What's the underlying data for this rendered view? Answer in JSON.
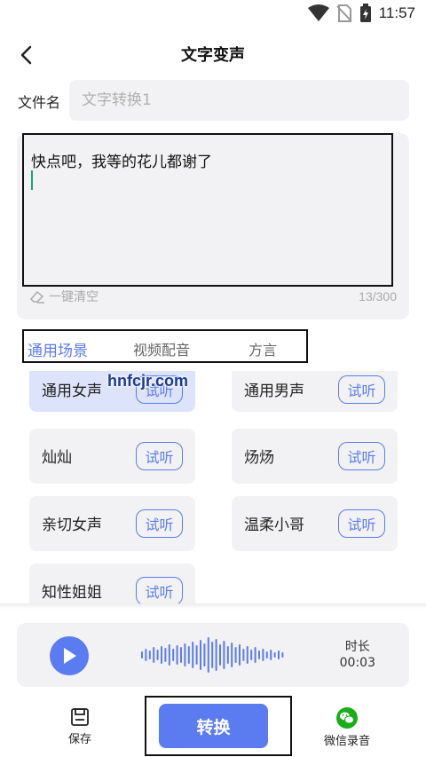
{
  "status_bar": {
    "time": "11:57",
    "icons": [
      "wifi-icon",
      "no-sim-icon",
      "battery-charging-icon"
    ]
  },
  "header": {
    "title": "文字变声",
    "back_icon": "chevron-left-icon"
  },
  "filename": {
    "label": "文件名",
    "placeholder": "文字转换1"
  },
  "text_editor": {
    "content": "快点吧，我等的花儿都谢了",
    "clear_label": "一键清空",
    "char_count": "13/300"
  },
  "tabs": [
    {
      "label": "通用场景",
      "active": true
    },
    {
      "label": "视频配音",
      "active": false
    },
    {
      "label": "方言",
      "active": false
    }
  ],
  "voices": [
    {
      "name": "通用女声",
      "try_label": "试听",
      "selected": true
    },
    {
      "name": "通用男声",
      "try_label": "试听",
      "selected": false
    },
    {
      "name": "灿灿",
      "try_label": "试听",
      "selected": false
    },
    {
      "name": "炀炀",
      "try_label": "试听",
      "selected": false
    },
    {
      "name": "亲切女声",
      "try_label": "试听",
      "selected": false
    },
    {
      "name": "温柔小哥",
      "try_label": "试听",
      "selected": false
    },
    {
      "name": "知性姐姐",
      "try_label": "试听",
      "selected": false
    }
  ],
  "watermark": "hnfcjr.com",
  "player": {
    "duration_label": "时长",
    "duration_value": "00:03"
  },
  "bottom_bar": {
    "save_label": "保存",
    "convert_label": "转换",
    "wechat_label": "微信录音"
  },
  "colors": {
    "accent": "#5b7bf0",
    "selected_card": "#dde3fb",
    "card_bg": "#f2f2f4",
    "wechat_green": "#1aad19",
    "caret": "#1aa37a"
  }
}
